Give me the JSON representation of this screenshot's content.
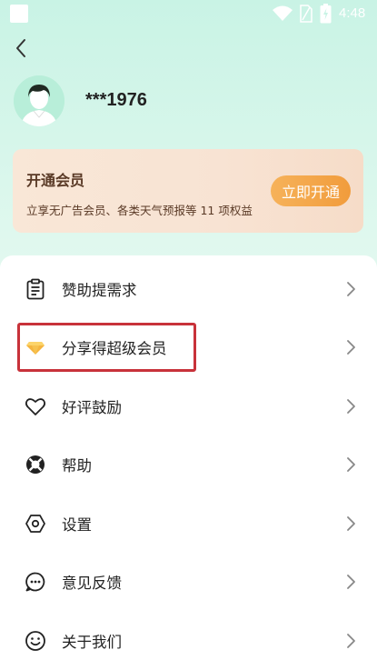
{
  "status_bar": {
    "time": "4:48"
  },
  "profile": {
    "username": "***1976"
  },
  "vip_card": {
    "title": "开通会员",
    "description": "立享无广告会员、各类天气预报等 11 项权益",
    "button_label": "立即开通"
  },
  "menu": {
    "items": [
      {
        "label": "赞助提需求",
        "icon": "clipboard-icon"
      },
      {
        "label": "分享得超级会员",
        "icon": "diamond-icon"
      },
      {
        "label": "好评鼓励",
        "icon": "heart-icon"
      },
      {
        "label": "帮助",
        "icon": "lifebuoy-icon"
      },
      {
        "label": "设置",
        "icon": "hexagon-settings-icon"
      },
      {
        "label": "意见反馈",
        "icon": "chat-bubble-icon"
      },
      {
        "label": "关于我们",
        "icon": "smiley-icon"
      }
    ]
  },
  "colors": {
    "accent_orange": "#f19c3c",
    "highlight_red": "#c8323a",
    "vip_text": "#5a3a26",
    "bg_mint": "#c9f3e5"
  }
}
